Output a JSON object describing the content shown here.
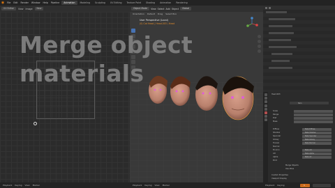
{
  "menubar": {
    "items": [
      "File",
      "Edit",
      "Render",
      "Window",
      "Help",
      "Pipeline"
    ],
    "workspaces": [
      "Animation",
      "Modeling",
      "Sculpting",
      "UV Editing",
      "Texture Paint",
      "Shading",
      "Animation",
      "Rendering",
      "Compositing",
      "Scripting"
    ],
    "scene": "Scene",
    "view_layer": "ViewLayer"
  },
  "image_editor": {
    "mode": "UV Editor",
    "view": "View",
    "image": "Image",
    "slot": "New"
  },
  "viewport": {
    "mode": "Object Mode",
    "menus": [
      "View",
      "Select",
      "Add",
      "Object"
    ],
    "transform": "Global",
    "subheader": [
      "Orientation",
      "Default",
      "Drag",
      "Select Box"
    ],
    "info_line1": "User Perspective (Local)",
    "info_line2": "(0) Cat Head | Head.003 / Head"
  },
  "overlay": {
    "title_line1": "Merge object",
    "title_line2": "materials"
  },
  "properties": {
    "object_name": "Head.003",
    "material_name": "Skin",
    "fields": [
      "Scale",
      "Range",
      "Dist",
      "Mass"
    ],
    "checks": [
      "Diffuse",
      "Shadow",
      "Specular",
      "Glossy",
      "Translu",
      "Normal",
      "Environ",
      "AO",
      "Alpha",
      "Emit"
    ],
    "buttons": [
      "Bake Diffuse",
      "Bake Shadow",
      "Bake Specular",
      "Bake Glossy",
      "Bake Normal",
      "Bake AO",
      "Bake Alpha",
      "Bake All"
    ],
    "options": [
      "Merge Objects",
      "Use Atlas"
    ],
    "sections": [
      "Custom Properties",
      "Viewport Display"
    ]
  },
  "timeline": {
    "left": [
      "Playback",
      "Keying",
      "View",
      "Marker"
    ],
    "mid": [
      "Playback",
      "Keying",
      "View",
      "Marker"
    ],
    "right": [
      "Playback",
      "Keying",
      "View",
      "Marker"
    ],
    "frame": "1"
  },
  "colors": {
    "accent_orange": "#e87d0d",
    "active_blue": "#4772b3",
    "title_gray": "#7b7b7b"
  }
}
